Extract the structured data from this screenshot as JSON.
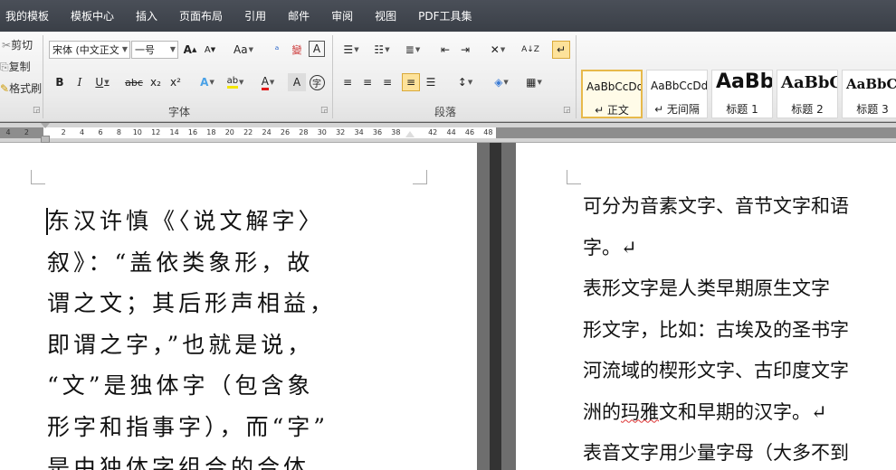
{
  "menu": [
    "我的模板",
    "模板中心",
    "插入",
    "页面布局",
    "引用",
    "邮件",
    "审阅",
    "视图",
    "PDF工具集"
  ],
  "clipboard": {
    "cut": "剪切",
    "copy": "复制",
    "format_painter": "格式刷"
  },
  "font_group": {
    "font_name": "宋体 (中文正文)",
    "font_size": "一号",
    "label": "字体",
    "grow": "A",
    "shrink": "A",
    "case": "Aa",
    "bold": "B",
    "italic": "I",
    "underline": "U",
    "strike": "abc",
    "subscript": "x₂",
    "superscript": "x²",
    "highlight": "ab",
    "font_color": "A",
    "char_shade": "A",
    "enclose": "字"
  },
  "paragraph_group": {
    "label": "段落",
    "sort": "A↓Z"
  },
  "styles": [
    {
      "sample": "AaBbCcDd",
      "name": "↵ 正文",
      "selected": true
    },
    {
      "sample": "AaBbCcDd",
      "name": "↵ 无间隔",
      "selected": false
    },
    {
      "sample": "AaBb",
      "name": "标题 1",
      "selected": false
    },
    {
      "sample": "AaBbC",
      "name": "标题 2",
      "selected": false
    },
    {
      "sample": "AaBbC",
      "name": "标题 3",
      "selected": false
    }
  ],
  "ruler_ticks": [
    "4",
    "2",
    "",
    "2",
    "4",
    "6",
    "8",
    "10",
    "12",
    "14",
    "16",
    "18",
    "20",
    "22",
    "24",
    "26",
    "28",
    "30",
    "32",
    "34",
    "36",
    "38",
    "",
    "42",
    "44",
    "46",
    "48"
  ],
  "left_page": {
    "text": "东汉许慎《〈说文解字〉\n叙》：“盖依类象形，故\n谓之文；其后形声相益，\n即谓之字，”也就是说，\n“文”是独体字（包含象\n形字和指事字），而“字”\n是由独体字组合的合体"
  },
  "right_page": {
    "line1": "可分为音素文字、音节文字和语",
    "line2": "字。↵",
    "line3": "表形文字是人类早期原生文字",
    "line4": "形文字，比如：古埃及的圣书字",
    "line5": "河流域的楔形文字、古印度文字",
    "line6a": "洲的",
    "line6b": "玛雅",
    "line6c": "文和早期的汉字。↵",
    "line7": "表音文字用少量字母（大多不到"
  }
}
